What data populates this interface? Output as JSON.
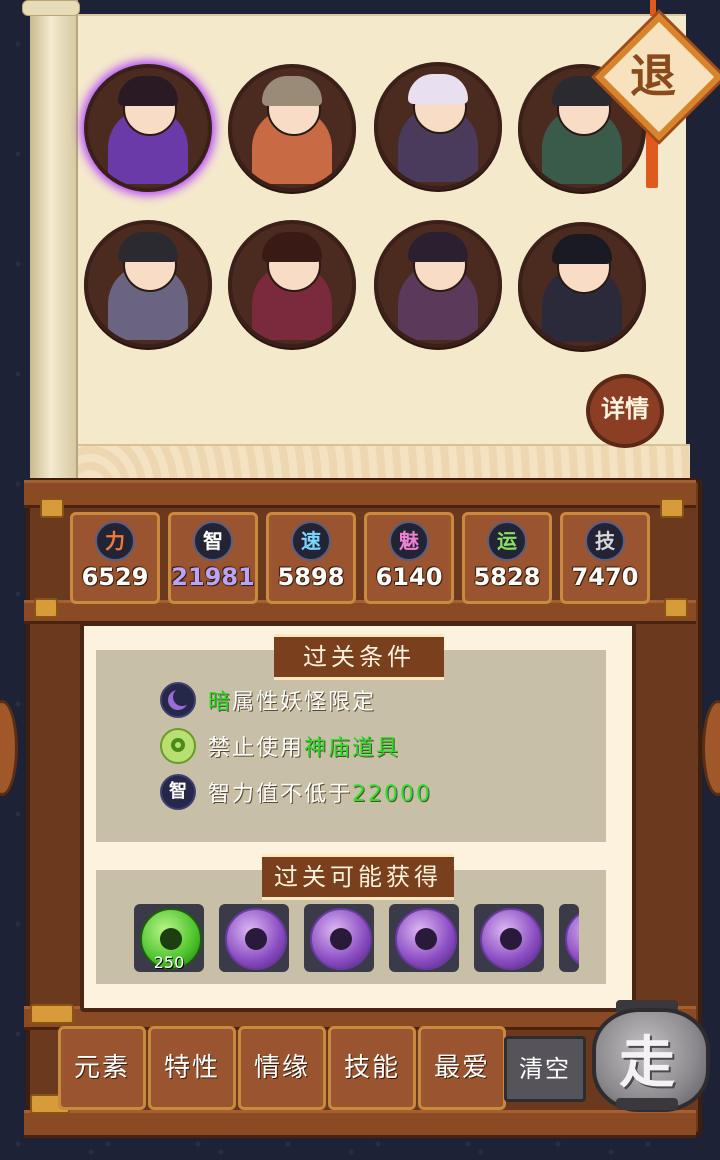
{
  "top_right": {
    "retreat_label": "退",
    "details_label": "详情"
  },
  "roster": [
    {
      "name": "hero-1",
      "hair": "#2a1a24",
      "body": "#6a3aa8",
      "ring": "#b040ff"
    },
    {
      "name": "hero-2",
      "hair": "#9a8a78",
      "body": "#c86a44",
      "ring": ""
    },
    {
      "name": "hero-3",
      "hair": "#e8e0f0",
      "body": "#4a3a5c",
      "ring": ""
    },
    {
      "name": "hero-4",
      "hair": "#2a2a30",
      "body": "#3a5a4a",
      "ring": ""
    },
    {
      "name": "hero-5",
      "hair": "#2a2a30",
      "body": "#6a6480",
      "ring": ""
    },
    {
      "name": "hero-6",
      "hair": "#3a1a14",
      "body": "#7a2a3a",
      "ring": ""
    },
    {
      "name": "hero-7",
      "hair": "#2a2030",
      "body": "#5a3a5a",
      "ring": ""
    },
    {
      "name": "hero-8",
      "hair": "#1a1a22",
      "body": "#2a2a3a",
      "ring": ""
    }
  ],
  "stats": [
    {
      "icon": "力",
      "value": "6529",
      "color": "#ffffff",
      "icon_color": "#f07a3a"
    },
    {
      "icon": "智",
      "value": "21981",
      "color": "#b8a4ff",
      "icon_color": "#ffffff"
    },
    {
      "icon": "速",
      "value": "5898",
      "color": "#ffffff",
      "icon_color": "#7ad8ff"
    },
    {
      "icon": "魅",
      "value": "6140",
      "color": "#ffffff",
      "icon_color": "#f080d0"
    },
    {
      "icon": "运",
      "value": "5828",
      "color": "#ffffff",
      "icon_color": "#8ae060"
    },
    {
      "icon": "技",
      "value": "7470",
      "color": "#ffffff",
      "icon_color": "#d8d8d8"
    }
  ],
  "conditions": {
    "title": "过关条件",
    "items": [
      {
        "icon": "moon-icon",
        "pre": "",
        "hl": "暗",
        "post": "属性妖怪限定"
      },
      {
        "icon": "magatama-icon",
        "pre": "禁止使用",
        "hl": "神庙道具",
        "post": ""
      },
      {
        "icon": "智",
        "pre": "智力值不低于",
        "hl": "22000",
        "post": ""
      }
    ]
  },
  "rewards": {
    "title": "过关可能获得",
    "items": [
      {
        "type": "green",
        "count": "250"
      },
      {
        "type": "purple",
        "count": ""
      },
      {
        "type": "purple",
        "count": ""
      },
      {
        "type": "purple",
        "count": ""
      },
      {
        "type": "purple",
        "count": ""
      },
      {
        "type": "purple",
        "count": ""
      }
    ]
  },
  "tabs": [
    "元素",
    "特性",
    "情缘",
    "技能",
    "最爱"
  ],
  "clear_label": "清空",
  "go_label": "走"
}
